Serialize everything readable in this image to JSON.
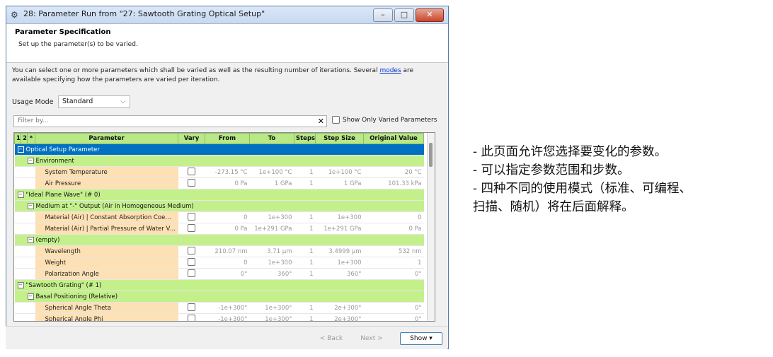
{
  "window": {
    "title": "28: Parameter Run from \"27: Sawtooth Grating Optical Setup\"",
    "buttons": {
      "minimize": "–",
      "maximize": "□",
      "close": "✕"
    }
  },
  "header": {
    "title": "Parameter Specification",
    "subtitle": "Set up the parameter(s) to be varied."
  },
  "description": {
    "before_link": "You can select one or more parameters which shall be varied as well as the resulting number of iterations. Several ",
    "link": "modes",
    "after_link": " are available specifying how the parameters are varied per iteration."
  },
  "usage": {
    "label": "Usage Mode",
    "value": "Standard"
  },
  "filter": {
    "placeholder": "Filter by...",
    "clear": "✕",
    "show_only_label": "Show Only Varied Parameters"
  },
  "table": {
    "headers": {
      "c1": "1",
      "c2": "2",
      "c3": "*",
      "parameter": "Parameter",
      "vary": "Vary",
      "from": "From",
      "to": "To",
      "steps": "Steps",
      "step_size": "Step Size",
      "original": "Original Value"
    },
    "rows": [
      {
        "kind": "blue",
        "indent": 0,
        "toggle": "−",
        "label": "Optical Setup Parameter"
      },
      {
        "kind": "green",
        "indent": 1,
        "toggle": "−",
        "label": "Environment"
      },
      {
        "kind": "param",
        "indent": 2,
        "label": "System Temperature",
        "from": "-273.15 °C",
        "to": "1e+100 °C",
        "steps": "1",
        "step_size": "1e+100 °C",
        "original": "20 °C"
      },
      {
        "kind": "param",
        "indent": 2,
        "label": "Air Pressure",
        "from": "0 Pa",
        "to": "1 GPa",
        "steps": "1",
        "step_size": "1 GPa",
        "original": "101.33 kPa"
      },
      {
        "kind": "green",
        "indent": 0,
        "toggle": "−",
        "label": "\"Ideal Plane Wave\" (# 0)"
      },
      {
        "kind": "green",
        "indent": 1,
        "toggle": "−",
        "label": "Medium at \"-\" Output (Air in Homogeneous Medium)"
      },
      {
        "kind": "param",
        "indent": 2,
        "label": "Material (Air) | Constant Absorption Coeffi...",
        "from": "0",
        "to": "1e+300",
        "steps": "1",
        "step_size": "1e+300",
        "original": "0"
      },
      {
        "kind": "param",
        "indent": 2,
        "label": "Material (Air) | Partial Pressure of Water Va...",
        "from": "0 Pa",
        "to": "1e+291 GPa",
        "steps": "1",
        "step_size": "1e+291 GPa",
        "original": "0 Pa"
      },
      {
        "kind": "green",
        "indent": 1,
        "toggle": "−",
        "label": "(empty)"
      },
      {
        "kind": "param",
        "indent": 2,
        "label": "Wavelength",
        "from": "210.07 nm",
        "to": "3.71 µm",
        "steps": "1",
        "step_size": "3.4999 µm",
        "original": "532 nm"
      },
      {
        "kind": "param",
        "indent": 2,
        "label": "Weight",
        "from": "0",
        "to": "1e+300",
        "steps": "1",
        "step_size": "1e+300",
        "original": "1"
      },
      {
        "kind": "param",
        "indent": 2,
        "label": "Polarization Angle",
        "from": "0°",
        "to": "360°",
        "steps": "1",
        "step_size": "360°",
        "original": "0°"
      },
      {
        "kind": "green",
        "indent": 0,
        "toggle": "−",
        "label": "\"Sawtooth Grating\" (# 1)"
      },
      {
        "kind": "green",
        "indent": 1,
        "toggle": "−",
        "label": "Basal Positioning (Relative)"
      },
      {
        "kind": "param",
        "indent": 2,
        "label": "Spherical Angle Theta",
        "from": "-1e+300°",
        "to": "1e+300°",
        "steps": "1",
        "step_size": "2e+300°",
        "original": "0°"
      },
      {
        "kind": "param",
        "indent": 2,
        "label": "Spherical Angle Phi",
        "from": "-1e+300°",
        "to": "1e+300°",
        "steps": "1",
        "step_size": "2e+300°",
        "original": "0°"
      }
    ]
  },
  "footer": {
    "back": "< Back",
    "next": "Next >",
    "show": "Show ▾"
  },
  "notes": [
    "- 此页面允许您选择要变化的参数。",
    "- 可以指定参数范围和步数。",
    "- 四种不同的使用模式（标准、可编程、",
    "扫描、随机）将在后面解释。"
  ]
}
